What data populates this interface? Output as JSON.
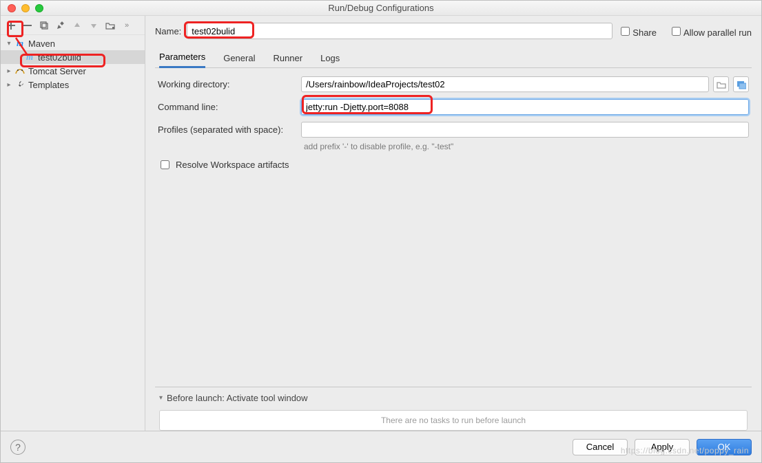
{
  "window": {
    "title": "Run/Debug Configurations"
  },
  "sidebar": {
    "items": [
      {
        "label": "Maven",
        "expanded": true,
        "icon": "m"
      },
      {
        "label": "test02bulid",
        "selected": true,
        "icon": "m"
      },
      {
        "label": "Tomcat Server",
        "expanded": false
      },
      {
        "label": "Templates",
        "expanded": false
      }
    ]
  },
  "form": {
    "name_label": "Name:",
    "name_value": "test02bulid",
    "share_label": "Share",
    "parallel_label": "Allow parallel run"
  },
  "tabs": {
    "parameters": "Parameters",
    "general": "General",
    "runner": "Runner",
    "logs": "Logs"
  },
  "params": {
    "workdir_label": "Working directory:",
    "workdir_value": "/Users/rainbow/IdeaProjects/test02",
    "cmd_label": "Command line:",
    "cmd_value": "jetty:run -Djetty.port=8088",
    "profiles_label": "Profiles (separated with space):",
    "profiles_value": "",
    "profiles_hint": "add prefix '-' to disable profile, e.g. \"-test\"",
    "resolve_label": "Resolve Workspace artifacts"
  },
  "before_launch": {
    "header": "Before launch: Activate tool window",
    "empty": "There are no tasks to run before launch"
  },
  "footer": {
    "cancel": "Cancel",
    "apply": "Apply",
    "ok": "OK"
  },
  "watermark": "https://blog.csdn.net/poppy_rain"
}
